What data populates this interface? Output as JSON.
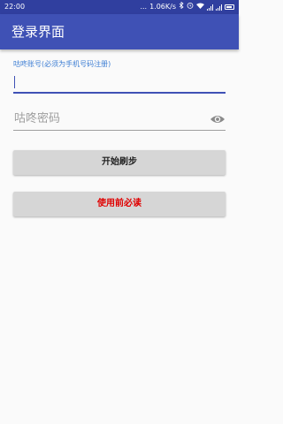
{
  "status_bar": {
    "time": "22:00",
    "dots": "...",
    "network_speed": "1.06K/s",
    "bluetooth_icon": "bluetooth-icon",
    "alarm_icon": "alarm-icon",
    "wifi_icon": "wifi-icon",
    "signal_icon": "signal-icon",
    "battery_icon": "battery-icon"
  },
  "app_bar": {
    "title": "登录界面"
  },
  "form": {
    "account": {
      "label": "咕咚账号(必须为手机号码注册)",
      "value": ""
    },
    "password": {
      "placeholder": "咕咚密码",
      "value": "",
      "toggle_icon": "eye-icon"
    }
  },
  "buttons": {
    "start_label": "开始刷步",
    "readme_label": "使用前必读"
  },
  "colors": {
    "status_bar": "#303f9f",
    "app_bar": "#3f51b5",
    "accent": "#3f51b5",
    "warning_text": "#e00000",
    "button_bg": "#d6d6d6"
  }
}
